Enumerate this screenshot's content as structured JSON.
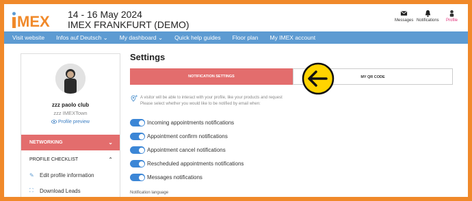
{
  "brand": {
    "logo_text": "IMEX",
    "colors": {
      "orange": "#f0892a",
      "blue": "#5d9bd2",
      "red": "#e36d6d",
      "toggle": "#3b86d6",
      "pink": "#e0307a"
    }
  },
  "event": {
    "dates": "14 - 16 May 2024",
    "name": "IMEX FRANKFURT (DEMO)"
  },
  "header_actions": [
    {
      "label": "Messages",
      "icon": "envelope-icon"
    },
    {
      "label": "Notifications",
      "icon": "bell-icon"
    },
    {
      "label": "Profile",
      "icon": "user-icon"
    }
  ],
  "nav": {
    "items": [
      "Visit website",
      "Infos auf Deutsch ⌄",
      "My dashboard ⌄",
      "Quick help guides",
      "Floor plan",
      "My IMEX account"
    ]
  },
  "sidebar": {
    "user_name": "zzz paolo club",
    "company": "zzz IMEXTown",
    "profile_preview": "Profile preview",
    "networking": "NETWORKING",
    "checklist": "PROFILE CHECKLIST",
    "links": [
      {
        "label": "Edit profile information",
        "icon": "pencil-icon"
      },
      {
        "label": "Download Leads",
        "icon": "download-icon"
      }
    ]
  },
  "main": {
    "title": "Settings",
    "tabs": [
      "NOTIFICATION SETTINGS",
      "MY QR CODE"
    ],
    "info_line1": "A visitor will be able to interact with your profile, like your products and request",
    "info_line2": "Please select whether you would like to be notified by email when:",
    "toggles": [
      "Incoming appointments notifications",
      "Appointment confirm notifications",
      "Appointment cancel notifications",
      "Rescheduled appointments notifications",
      "Messages notifications"
    ],
    "notification_language": "Notification language"
  }
}
